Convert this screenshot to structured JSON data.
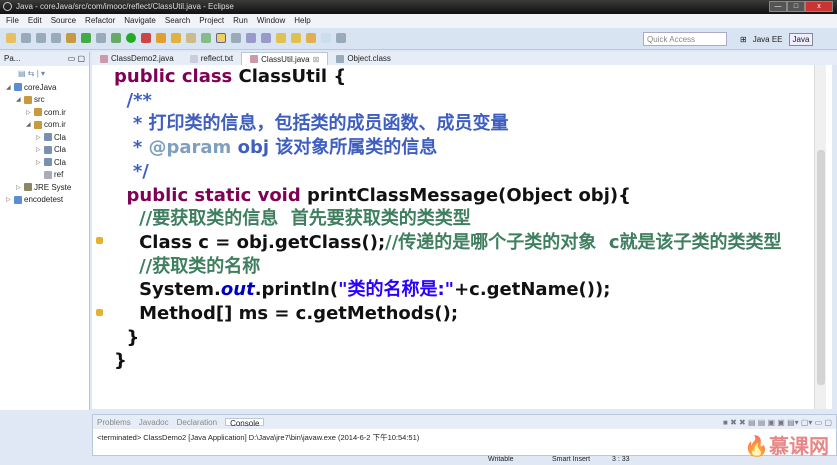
{
  "window": {
    "title": "Java - coreJava/src/com/imooc/reflect/ClassUtil.java - Eclipse",
    "min": "—",
    "max": "□",
    "close": "x"
  },
  "menu": [
    "File",
    "Edit",
    "Source",
    "Refactor",
    "Navigate",
    "Search",
    "Project",
    "Run",
    "Window",
    "Help"
  ],
  "toolbar": {
    "quick_access_placeholder": "Quick Access",
    "perspectives": [
      "Java EE",
      "Java"
    ]
  },
  "package_explorer": {
    "title": "Pa...",
    "items": [
      {
        "label": "coreJava",
        "indent": 1,
        "expanded": "◢",
        "color": "#5a8ed0"
      },
      {
        "label": "src",
        "indent": 2,
        "expanded": "◢",
        "color": "#c89a40"
      },
      {
        "label": "com.ir",
        "indent": 3,
        "expanded": "▷",
        "color": "#c89a40"
      },
      {
        "label": "com.ir",
        "indent": 3,
        "expanded": "◢",
        "color": "#c89a40"
      },
      {
        "label": "Cla",
        "indent": 4,
        "expanded": "▷",
        "color": "#7a90b0"
      },
      {
        "label": "Cla",
        "indent": 4,
        "expanded": "▷",
        "color": "#7a90b0"
      },
      {
        "label": "Cla",
        "indent": 4,
        "expanded": "▷",
        "color": "#7a90b0"
      },
      {
        "label": "ref",
        "indent": 4,
        "expanded": "",
        "color": "#aab"
      },
      {
        "label": "JRE Syste",
        "indent": 2,
        "expanded": "▷",
        "color": "#886"
      },
      {
        "label": "encodetest",
        "indent": 1,
        "expanded": "▷",
        "color": "#5a8ed0"
      }
    ]
  },
  "editor_tabs": [
    {
      "label": "ClassDemo2.java",
      "active": false
    },
    {
      "label": "reflect.txt",
      "active": false
    },
    {
      "label": "ClassUtil.java",
      "active": true,
      "close": "⊠"
    },
    {
      "label": "Object.class",
      "active": false
    }
  ],
  "code": {
    "l1_kw": "public class ",
    "l1_name": "ClassUtil {",
    "l2": "/**",
    "l3": " * 打印类的信息，包括类的成员函数、成员变量",
    "l4_star": " * ",
    "l4_tag": "@param",
    "l4_rest": " obj 该对象所属类的信息",
    "l5": " */",
    "l6_kw": "public static void ",
    "l6_rest": "printClassMessage(Object obj){",
    "l7": "//要获取类的信息  首先要获取类的类类型",
    "l8_code": "Class c = obj.getClass();",
    "l8_cm": "//传递的是哪个子类的对象  c就是该子类的类类型",
    "l9": "//获取类的名称",
    "l10_a": "System.",
    "l10_out": "out",
    "l10_b": ".println(",
    "l10_str": "\"类的名称是:\"",
    "l10_c": "+c.getName());",
    "l11": "Method[] ms = c.getMethods();",
    "l12": "}",
    "l13": "}"
  },
  "bottom": {
    "tabs": [
      "Problems",
      "Javadoc",
      "Declaration",
      "Console"
    ],
    "active": "Console",
    "console": "<terminated> ClassDemo2 [Java Application] D:\\Java\\jre7\\bin\\javaw.exe (2014-6-2 下午10:54:51)"
  },
  "status": {
    "mode": "Writable",
    "insert": "Smart Insert",
    "position": "3 : 33"
  },
  "watermark": "慕课网"
}
